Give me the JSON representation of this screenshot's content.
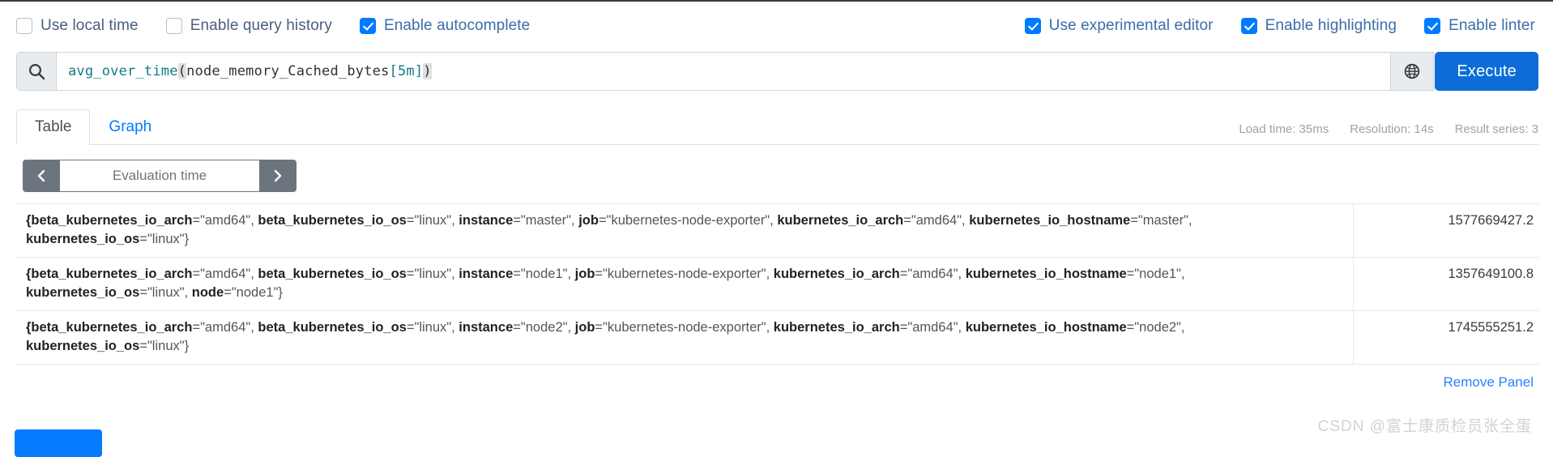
{
  "options": {
    "left": [
      {
        "label": "Use local time",
        "checked": false,
        "name": "use-local-time"
      },
      {
        "label": "Enable query history",
        "checked": false,
        "name": "enable-query-history"
      },
      {
        "label": "Enable autocomplete",
        "checked": true,
        "name": "enable-autocomplete"
      }
    ],
    "right": [
      {
        "label": "Use experimental editor",
        "checked": true,
        "name": "use-experimental-editor"
      },
      {
        "label": "Enable highlighting",
        "checked": true,
        "name": "enable-highlighting"
      },
      {
        "label": "Enable linter",
        "checked": true,
        "name": "enable-linter"
      }
    ]
  },
  "query": {
    "expression": "avg_over_time(node_memory_Cached_bytes[5m])",
    "tokens": {
      "func": "avg_over_time",
      "open_paren": "(",
      "metric": "node_memory_Cached_bytes",
      "open_bracket": "[",
      "duration": "5m",
      "close_bracket": "]",
      "close_paren": ")"
    },
    "search_icon": "search-icon",
    "globe_icon": "globe-icon",
    "execute_label": "Execute"
  },
  "tabs": [
    {
      "label": "Table",
      "active": true
    },
    {
      "label": "Graph",
      "active": false
    }
  ],
  "stats": {
    "load_time": "Load time: 35ms",
    "resolution": "Resolution: 14s",
    "result_series": "Result series: 3"
  },
  "evaluation_time": {
    "prev_icon": "chevron-left-icon",
    "next_icon": "chevron-right-icon",
    "placeholder": "Evaluation time",
    "value": ""
  },
  "results": {
    "rows": [
      {
        "value": "1577669427.2",
        "labels": [
          {
            "key": "{beta_kubernetes_io_arch",
            "val": "\"amd64\""
          },
          {
            "key": "beta_kubernetes_io_os",
            "val": "\"linux\""
          },
          {
            "key": "instance",
            "val": "\"master\""
          },
          {
            "key": "job",
            "val": "\"kubernetes-node-exporter\""
          },
          {
            "key": "kubernetes_io_arch",
            "val": "\"amd64\""
          },
          {
            "key": "kubernetes_io_hostname",
            "val": "\"master\""
          },
          {
            "key": "kubernetes_io_os",
            "val": "\"linux\"}"
          }
        ]
      },
      {
        "value": "1357649100.8",
        "labels": [
          {
            "key": "{beta_kubernetes_io_arch",
            "val": "\"amd64\""
          },
          {
            "key": "beta_kubernetes_io_os",
            "val": "\"linux\""
          },
          {
            "key": "instance",
            "val": "\"node1\""
          },
          {
            "key": "job",
            "val": "\"kubernetes-node-exporter\""
          },
          {
            "key": "kubernetes_io_arch",
            "val": "\"amd64\""
          },
          {
            "key": "kubernetes_io_hostname",
            "val": "\"node1\""
          },
          {
            "key": "kubernetes_io_os",
            "val": "\"linux\""
          },
          {
            "key": "node",
            "val": "\"node1\"}"
          }
        ]
      },
      {
        "value": "1745555251.2",
        "labels": [
          {
            "key": "{beta_kubernetes_io_arch",
            "val": "\"amd64\""
          },
          {
            "key": "beta_kubernetes_io_os",
            "val": "\"linux\""
          },
          {
            "key": "instance",
            "val": "\"node2\""
          },
          {
            "key": "job",
            "val": "\"kubernetes-node-exporter\""
          },
          {
            "key": "kubernetes_io_arch",
            "val": "\"amd64\""
          },
          {
            "key": "kubernetes_io_hostname",
            "val": "\"node2\""
          },
          {
            "key": "kubernetes_io_os",
            "val": "\"linux\"}"
          }
        ]
      }
    ]
  },
  "footer": {
    "remove_panel": "Remove Panel",
    "add_panel": "",
    "watermark": "CSDN @富士康质检员张全蛋"
  },
  "colors": {
    "accent": "#007bff",
    "execute": "#0d6dd8",
    "eval_control": "#6c757d",
    "function_token": "#0e7c86",
    "watermark": "#d2d2d2"
  }
}
